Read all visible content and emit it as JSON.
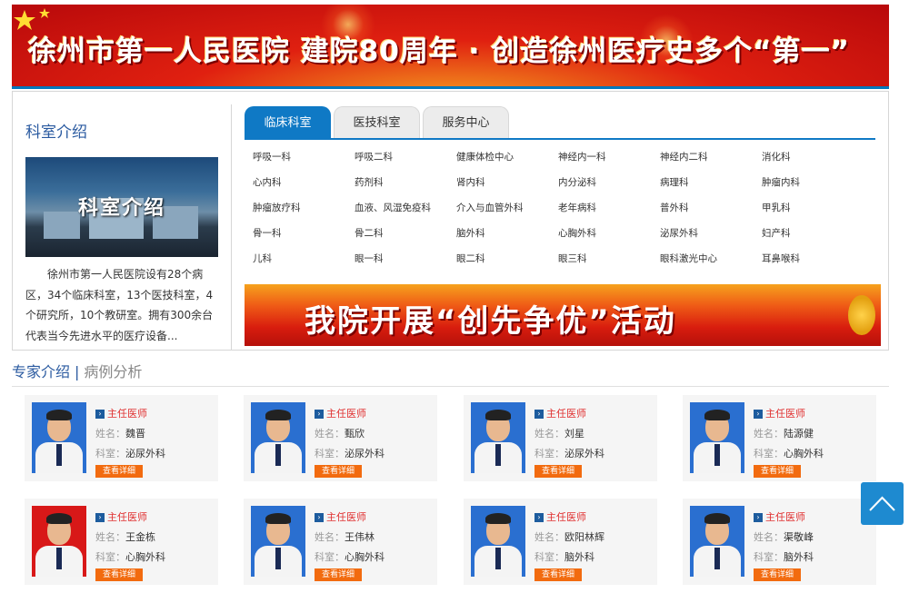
{
  "top_banner": {
    "title": "徐州市第一人民医院 建院80周年 · 创造徐州医疗史多个“第一”",
    "colors": {
      "primary": "#d81d0e",
      "accent": "#f5a020"
    }
  },
  "dept_intro": {
    "title": "科室介绍",
    "photo_text": "科室介绍",
    "text": "徐州市第一人民医院设有28个病区，34个临床科室，13个医技科室，4个研究所，10个教研室。拥有300余台代表当今先进水平的医疗设备..."
  },
  "tabs": [
    {
      "label": "临床科室",
      "active": true
    },
    {
      "label": "医技科室",
      "active": false
    },
    {
      "label": "服务中心",
      "active": false
    }
  ],
  "departments": [
    [
      "呼吸一科",
      "呼吸二科",
      "健康体检中心",
      "神经内一科",
      "神经内二科",
      "消化科"
    ],
    [
      "心内科",
      "药剂科",
      "肾内科",
      "内分泌科",
      "病理科",
      "肿瘤内科"
    ],
    [
      "肿瘤放疗科",
      "血液、风湿免疫科",
      "介入与血管外科",
      "老年病科",
      "普外科",
      "甲乳科"
    ],
    [
      "骨一科",
      "骨二科",
      "脑外科",
      "心胸外科",
      "泌尿外科",
      "妇产科"
    ],
    [
      "儿科",
      "眼一科",
      "眼二科",
      "眼三科",
      "眼科激光中心",
      "耳鼻喉科"
    ]
  ],
  "mid_banner": {
    "title": "我院开展“创先争优”活动"
  },
  "experts_section": {
    "tab_active": "专家介绍",
    "separator": "|",
    "tab_other": "病例分析",
    "role_label": "主任医师",
    "name_key": "姓名：",
    "dept_key": "科室：",
    "detail_button": "查看详细",
    "doctors": [
      {
        "name": "魏晋",
        "dept": "泌尿外科",
        "bg": "#2a6fd0"
      },
      {
        "name": "甄欣",
        "dept": "泌尿外科",
        "bg": "#2a6fd0"
      },
      {
        "name": "刘星",
        "dept": "泌尿外科",
        "bg": "#2a6fd0"
      },
      {
        "name": "陆源健",
        "dept": "心胸外科",
        "bg": "#2a6fd0"
      },
      {
        "name": "王金栋",
        "dept": "心胸外科",
        "bg": "#d81818"
      },
      {
        "name": "王伟林",
        "dept": "心胸外科",
        "bg": "#2a6fd0"
      },
      {
        "name": "欧阳林辉",
        "dept": "脑外科",
        "bg": "#2a6fd0"
      },
      {
        "name": "渠敬峰",
        "dept": "脑外科",
        "bg": "#2a6fd0"
      }
    ]
  },
  "back_to_top": {
    "icon": "chevron-up-icon"
  }
}
